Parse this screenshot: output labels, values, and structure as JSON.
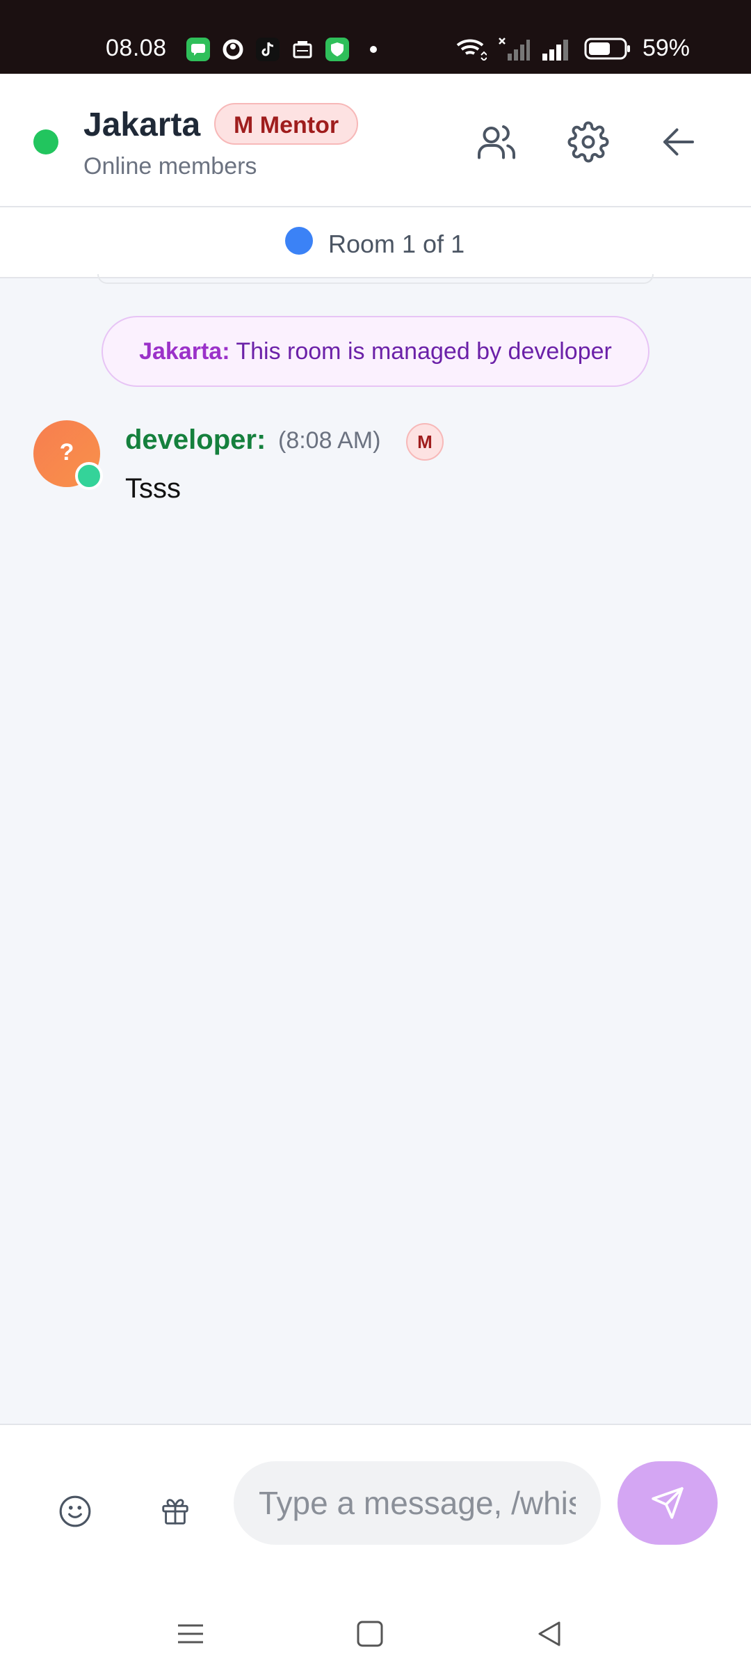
{
  "status_bar": {
    "time": "08.08",
    "battery_percent": "59%",
    "battery_level": 0.59,
    "notification_icons": [
      "messages-icon",
      "circle-app-icon",
      "tiktok-icon",
      "app-icon",
      "shield-icon"
    ]
  },
  "header": {
    "room_name": "Jakarta",
    "role_badge": "M Mentor",
    "subtitle": "Online members",
    "status_color": "#22c55e"
  },
  "room_indicator": {
    "label": "Room 1 of 1",
    "color": "#3b82f6"
  },
  "system_message": {
    "name": "Jakarta:",
    "text": " This room is managed by developer"
  },
  "messages": [
    {
      "avatar_text": "?",
      "username": "developer:",
      "time": "(8:08 AM)",
      "badge": "M",
      "text": "Tsss"
    }
  ],
  "composer": {
    "placeholder": "Type a message, /whisper"
  },
  "colors": {
    "accent_purple": "#d4a6f3",
    "username_green": "#15803d",
    "badge_red": "#9f1d1d"
  }
}
